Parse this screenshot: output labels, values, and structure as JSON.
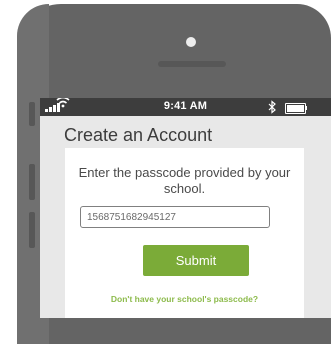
{
  "status_bar": {
    "time": "9:41 AM",
    "icons": [
      "signal-icon",
      "wifi-icon",
      "bluetooth-icon",
      "battery-icon"
    ]
  },
  "screen": {
    "title": "Create an Account",
    "instructions": "Enter the passcode provided by your school.",
    "passcode_value": "1568751682945127",
    "submit_label": "Submit",
    "help_link": "Don't have your school's passcode?"
  },
  "colors": {
    "phone_body": "#646464",
    "accent": "#7bab38",
    "link": "#8dbb4c",
    "status_bar": "#3d3d3d"
  }
}
